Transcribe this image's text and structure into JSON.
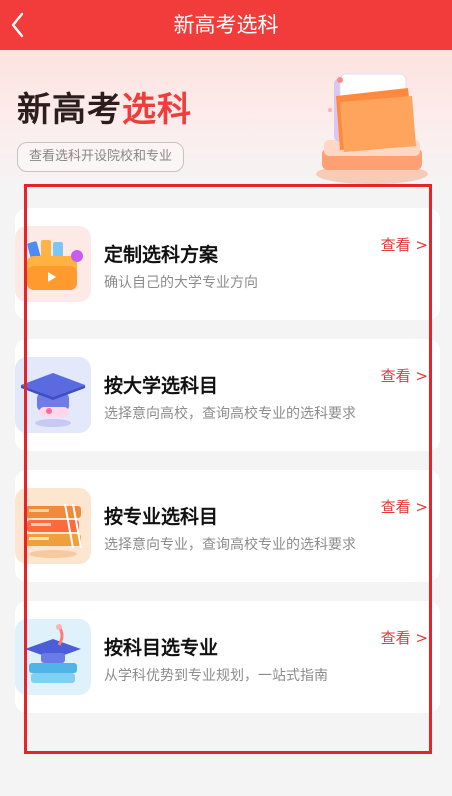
{
  "header": {
    "title": "新高考选科",
    "back_icon": "chevron-left-icon"
  },
  "banner": {
    "title_dark": "新高考",
    "title_red": "选科",
    "subtitle": "查看选科开设院校和专业",
    "art_icon": "folder-illustration"
  },
  "colors": {
    "accent": "#f23c3c",
    "link": "#e23a3a"
  },
  "cards": [
    {
      "title": "定制选科方案",
      "desc": "确认自己的大学专业方向",
      "link": "查看 >",
      "icon": "folder-books-icon"
    },
    {
      "title": "按大学选科目",
      "desc": "选择意向高校，查询高校专业的选科要求",
      "link": "查看 >",
      "icon": "graduation-cap-icon"
    },
    {
      "title": "按专业选科目",
      "desc": "选择意向专业，查询高校专业的选科要求",
      "link": "查看 >",
      "icon": "bookshelf-icon"
    },
    {
      "title": "按科目选专业",
      "desc": "从学科优势到专业规划，一站式指南",
      "link": "查看 >",
      "icon": "cap-books-icon"
    }
  ]
}
